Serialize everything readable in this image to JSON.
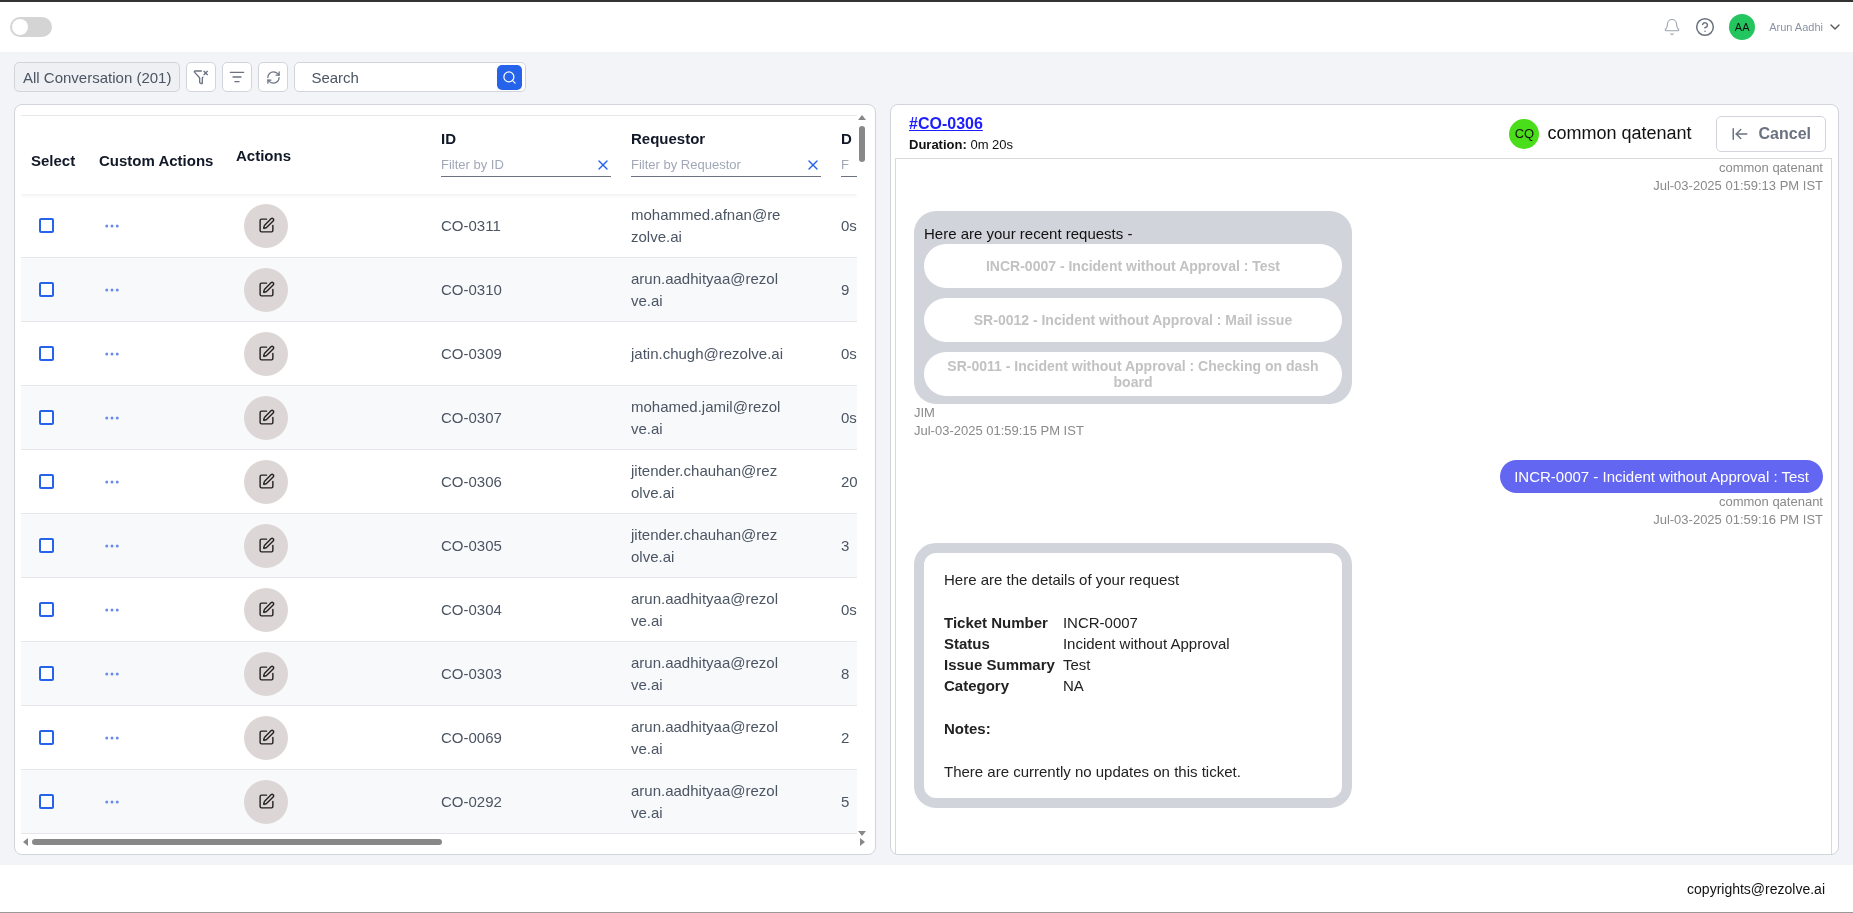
{
  "header": {
    "toggle": {
      "on": false
    },
    "user": {
      "initials": "AA",
      "name": "Arun Aadhi"
    }
  },
  "toolbar": {
    "view": "All Conversation (201)",
    "search": {
      "placeholder": "Search"
    }
  },
  "table": {
    "columns": [
      {
        "label": "Select"
      },
      {
        "label": "Custom Actions"
      },
      {
        "label": "Actions"
      },
      {
        "label": "ID",
        "filter_placeholder": "Filter by ID"
      },
      {
        "label": "Requestor",
        "filter_placeholder": "Filter by Requestor"
      },
      {
        "label": "D",
        "filter_placeholder": "F"
      }
    ],
    "rows": [
      {
        "checked": false,
        "id": "CO-0311",
        "requestor": "mohammed.afnan@rezolve.ai",
        "column_6": "0s"
      },
      {
        "checked": false,
        "id": "CO-0310",
        "requestor": "arun.aadhityaa@rezolve.ai",
        "column_6": "9"
      },
      {
        "checked": false,
        "id": "CO-0309",
        "requestor": "jatin.chugh@rezolve.ai",
        "column_6": "0s"
      },
      {
        "checked": false,
        "id": "CO-0307",
        "requestor": "mohamed.jamil@rezolve.ai",
        "column_6": "0s"
      },
      {
        "checked": false,
        "id": "CO-0306",
        "requestor": "jitender.chauhan@rezolve.ai",
        "column_6": "20"
      },
      {
        "checked": false,
        "id": "CO-0305",
        "requestor": "jitender.chauhan@rezolve.ai",
        "column_6": "3"
      },
      {
        "checked": false,
        "id": "CO-0304",
        "requestor": "arun.aadhityaa@rezolve.ai",
        "column_6": "0s"
      },
      {
        "checked": false,
        "id": "CO-0303",
        "requestor": "arun.aadhityaa@rezolve.ai",
        "column_6": "8"
      },
      {
        "checked": false,
        "id": "CO-0069",
        "requestor": "arun.aadhityaa@rezolve.ai",
        "column_6": "2"
      },
      {
        "checked": false,
        "id": "CO-0292",
        "requestor": "arun.aadhityaa@rezolve.ai",
        "column_6": "5"
      }
    ]
  },
  "chat": {
    "ticket": "#CO-0306",
    "duration_label": "Duration:",
    "duration": "0m 20s",
    "user": {
      "initials": "CQ",
      "name": "common qatenant"
    },
    "cancel": "Cancel",
    "messages": [
      {
        "kind": "meta",
        "sender": "common qatenant",
        "time": "Jul-03-2025 01:59:13 PM IST"
      },
      {
        "kind": "options",
        "text": "Here are your recent requests -",
        "options": [
          "INCR-0007 - Incident without Approval : Test",
          "SR-0012 - Incident without Approval : Mail issue",
          "SR-0011 - Incident without Approval : Checking on dash board"
        ],
        "sender": "JIM",
        "time": "Jul-03-2025 01:59:15 PM IST"
      },
      {
        "kind": "user",
        "text": "INCR-0007 - Incident without Approval : Test",
        "sender": "common qatenant",
        "time": "Jul-03-2025 01:59:16 PM IST"
      },
      {
        "kind": "card",
        "intro": "Here are the details of your request",
        "fields": [
          {
            "label": "Ticket Number",
            "value": "INCR-0007"
          },
          {
            "label": "Status",
            "value": "Incident without Approval"
          },
          {
            "label": "Issue Summary",
            "value": "Test"
          },
          {
            "label": "Category",
            "value": "NA"
          }
        ],
        "notes_label": "Notes:",
        "notes": "There are currently no updates on this ticket."
      }
    ]
  },
  "footer": "copyrights@rezolve.ai"
}
